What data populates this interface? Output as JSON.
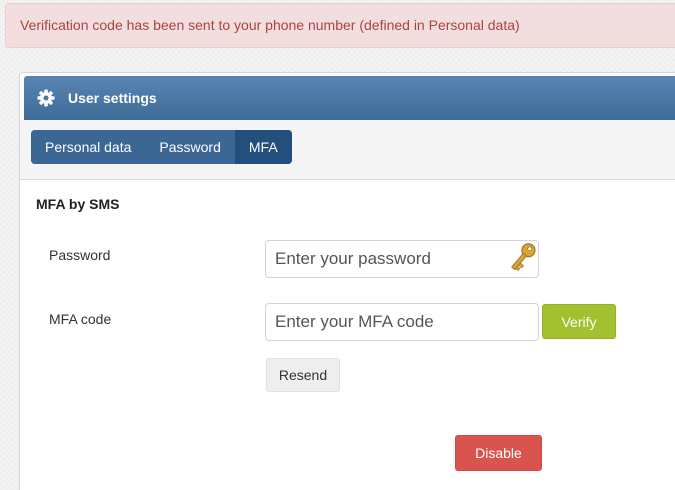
{
  "alert": {
    "message": "Verification code has been sent to your phone number (defined in Personal data)"
  },
  "panel": {
    "title": "User settings",
    "title_icon": "gear-icon",
    "tabs": [
      {
        "label": "Personal data",
        "active": false
      },
      {
        "label": "Password",
        "active": false
      },
      {
        "label": "MFA",
        "active": true
      }
    ]
  },
  "mfa": {
    "section_title": "MFA by SMS",
    "password_label": "Password",
    "password_placeholder": "Enter your password",
    "password_icon": "key-icon",
    "code_label": "MFA code",
    "code_placeholder": "Enter your MFA code",
    "verify_label": "Verify",
    "resend_label": "Resend",
    "disable_label": "Disable"
  },
  "colors": {
    "alert_text": "#a94442",
    "alert_bg": "#f2dede",
    "header_bg": "#4a76a3",
    "tab_active": "#234f7c",
    "verify": "#a2c12f",
    "disable": "#d9534f"
  }
}
